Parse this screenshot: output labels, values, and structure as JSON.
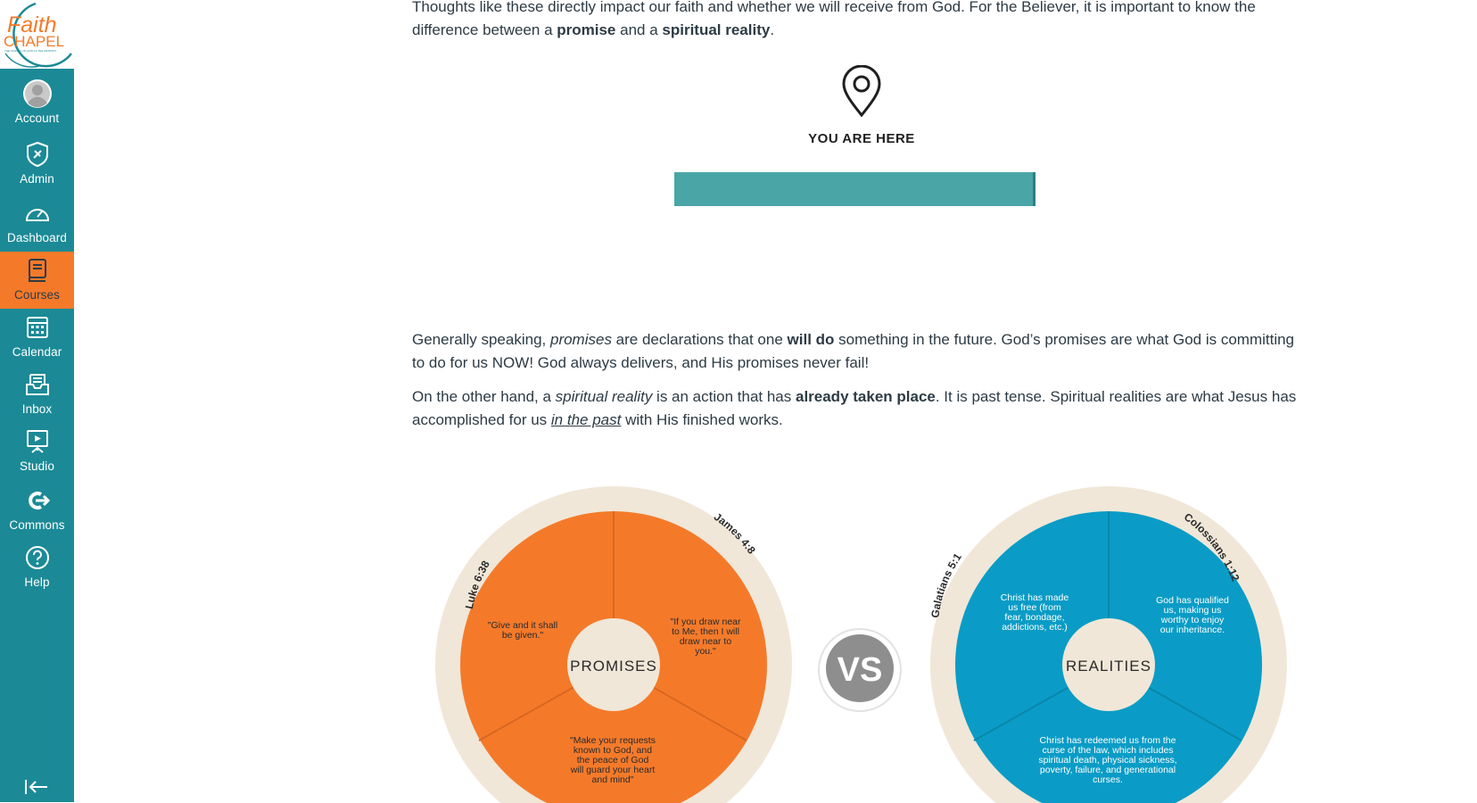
{
  "logo": {
    "top_text": "Faith",
    "bottom_text": "CHAPEL",
    "tagline": "THE SCHOOL OF FAITH & THE MINISTRY"
  },
  "sidebar": {
    "items": [
      {
        "label": "Account",
        "icon": "avatar-icon"
      },
      {
        "label": "Admin",
        "icon": "shield-icon"
      },
      {
        "label": "Dashboard",
        "icon": "dashboard-icon"
      },
      {
        "label": "Courses",
        "icon": "book-icon",
        "active": true
      },
      {
        "label": "Calendar",
        "icon": "calendar-icon"
      },
      {
        "label": "Inbox",
        "icon": "inbox-icon"
      },
      {
        "label": "Studio",
        "icon": "studio-icon"
      },
      {
        "label": "Commons",
        "icon": "commons-icon"
      },
      {
        "label": "Help",
        "icon": "help-icon"
      }
    ],
    "collapse_icon": "collapse-icon"
  },
  "colors": {
    "sidebar": "#1b8a96",
    "active": "#f47a2a",
    "promises": "#f47a2a",
    "realities": "#0a9cc6",
    "bar": "#4aa6a6"
  },
  "content": {
    "top_line_cut": "Thoughts like these directly impact our faith and whether we will receive from God. For the Believer, it is important to know the",
    "top_line_rest_a": "difference between a ",
    "top_bold_1": "promise",
    "top_line_rest_b": " and a ",
    "top_bold_2": "spiritual reality",
    "top_line_end": ".",
    "you_are_here": "YOU ARE HERE",
    "para1": {
      "a": "Generally speaking, ",
      "i1": "promises",
      "b": " are declarations that one ",
      "bold": "will do",
      "c": " something in the future. God’s promises are what God is committing to do for us NOW! God always delivers, and His promises never fail!"
    },
    "para2": {
      "a": "On the other hand, a ",
      "i1": "spiritual reality",
      "b": " is an action that has ",
      "bold": "already taken place",
      "c": ". It is past tense. Spiritual realities are what Jesus has accomplished for us ",
      "link": "in the past",
      "d": " with His finished works."
    }
  },
  "diagram": {
    "vs": "VS",
    "promises": {
      "center": "PROMISES",
      "refs": [
        "Luke 6:38",
        "James 4:8"
      ],
      "quotes": [
        [
          "\"Give and it shall",
          "be given.\""
        ],
        [
          "\"If you draw near",
          "to Me, then I will",
          "draw near to",
          "you.\""
        ],
        [
          "\"Make your requests",
          "known to God, and",
          "the peace of God",
          "will guard your heart",
          "and mind\""
        ]
      ]
    },
    "realities": {
      "center": "REALITIES",
      "refs": [
        "Galatians 5:1",
        "Colossians 1:12"
      ],
      "quotes": [
        [
          "Christ has made",
          "us free (from",
          "fear, bondage,",
          "addictions, etc.)"
        ],
        [
          "God has qualified",
          "us, making us",
          "worthy to enjoy",
          "our inheritance."
        ],
        [
          "Christ has redeemed us from the",
          "curse of the law, which includes",
          "spiritual death, physical sickness,",
          "poverty, failure, and generational",
          "curses."
        ]
      ]
    }
  }
}
